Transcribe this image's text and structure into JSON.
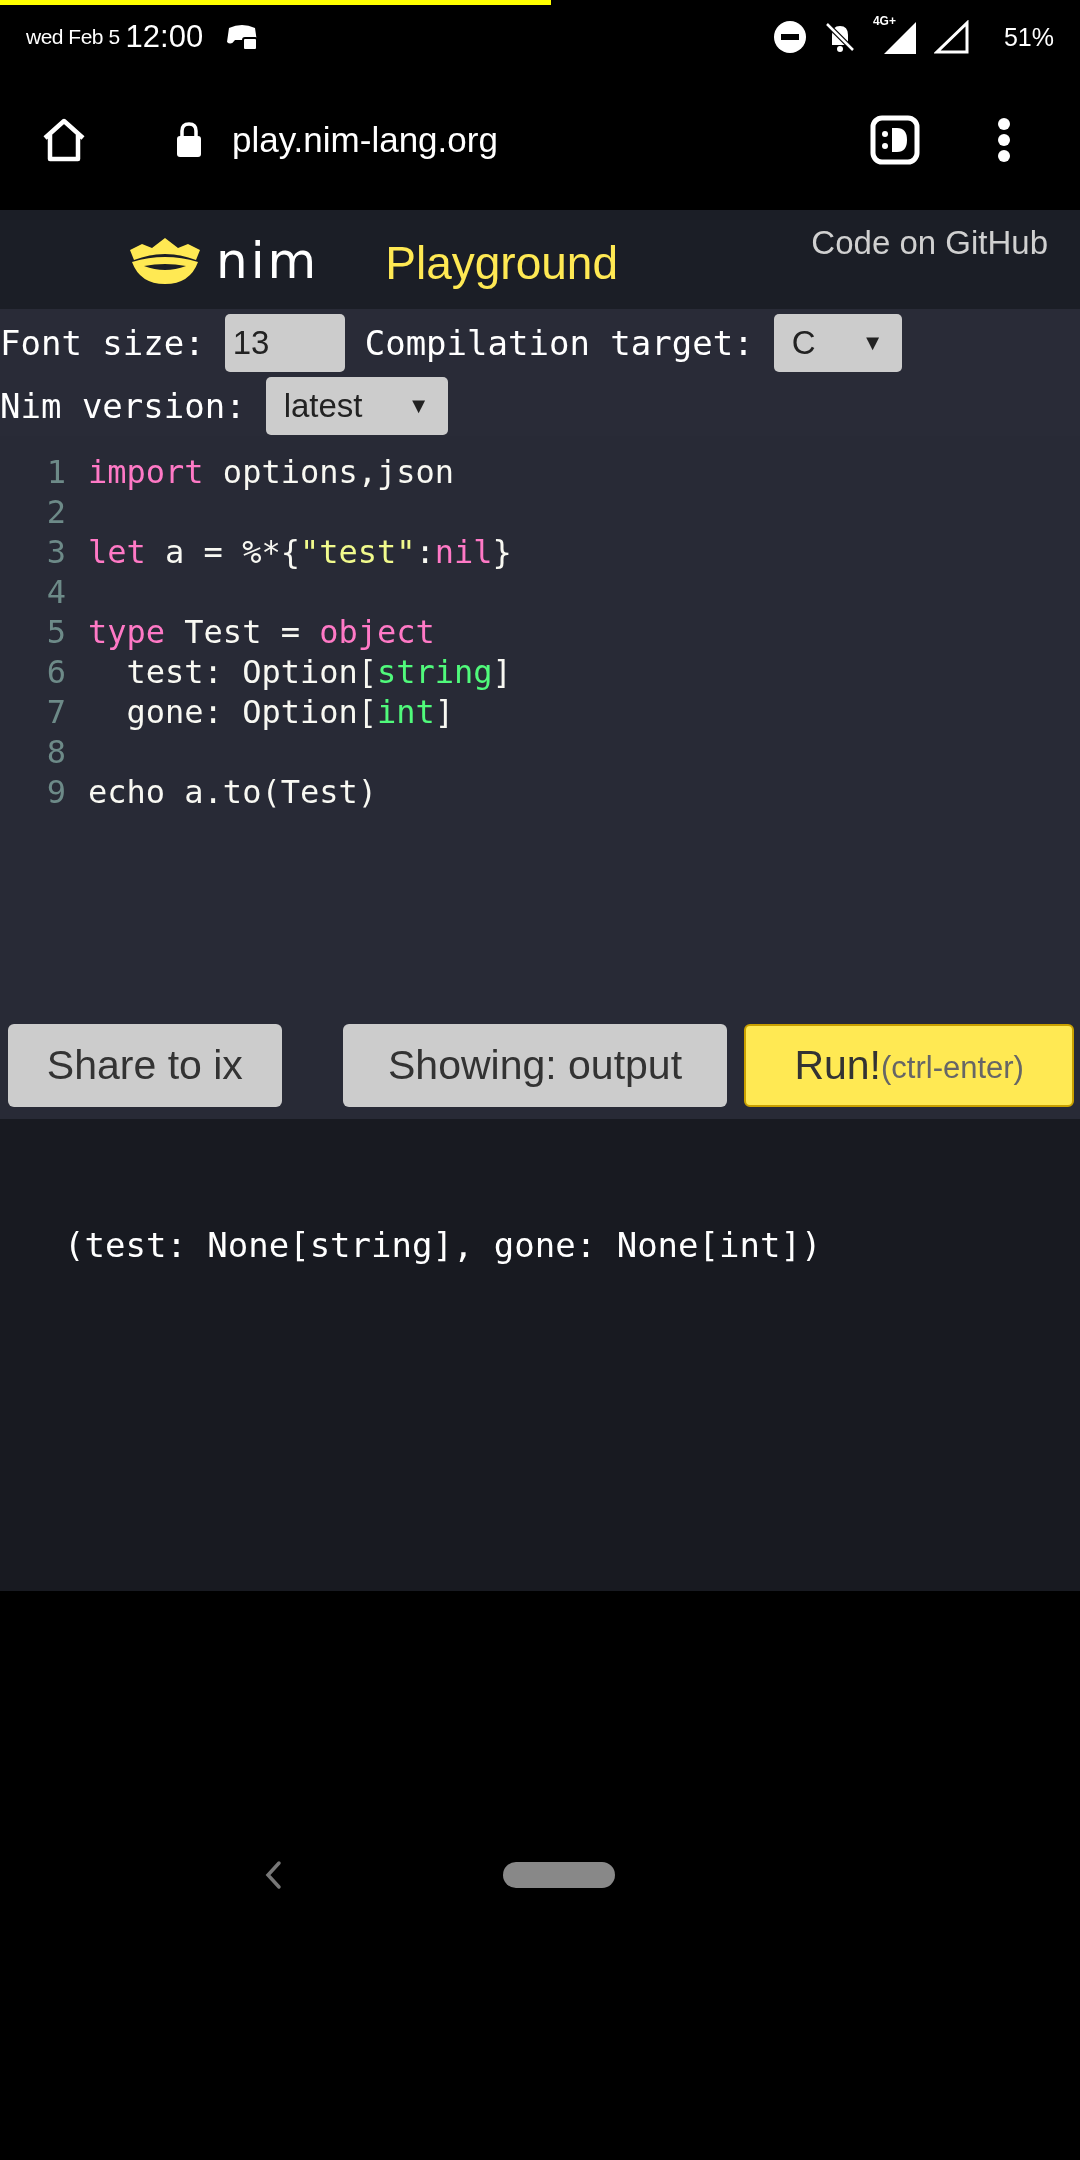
{
  "page_load": {
    "level": 0.51
  },
  "status_bar": {
    "date": "wed Feb 5",
    "time": "12:00",
    "network": "4G+",
    "battery": "51%"
  },
  "browser": {
    "url": "play.nim-lang.org"
  },
  "header": {
    "logo_text": "nim",
    "title": "Playground",
    "github_link": "Code on GitHub"
  },
  "controls": {
    "font_size_label": "Font size:",
    "font_size": "13",
    "target_label": "Compilation target:",
    "target": "C",
    "version_label": "Nim version:",
    "version": "latest",
    "dropdown_arrow": "▼"
  },
  "editor": {
    "lines": [
      {
        "number": "1",
        "tokens": [
          {
            "kind": "keyword",
            "text": "import"
          },
          {
            "kind": "plain",
            "text": " options,json"
          }
        ]
      },
      {
        "number": "2"
      },
      {
        "number": "3",
        "tokens": [
          {
            "kind": "keyword",
            "text": "let"
          },
          {
            "kind": "plain",
            "text": " a = %*{"
          },
          {
            "kind": "string",
            "text": "\"test\""
          },
          {
            "kind": "plain",
            "text": ":"
          },
          {
            "kind": "keyword",
            "text": "nil"
          },
          {
            "kind": "plain",
            "text": "}"
          }
        ]
      },
      {
        "number": "4"
      },
      {
        "number": "5",
        "tokens": [
          {
            "kind": "keyword",
            "text": "type"
          },
          {
            "kind": "plain",
            "text": " Test = "
          },
          {
            "kind": "keyword",
            "text": "object"
          }
        ]
      },
      {
        "number": "6",
        "tokens": [
          {
            "kind": "plain",
            "text": "  test: Option["
          },
          {
            "kind": "type",
            "text": "string"
          },
          {
            "kind": "plain",
            "text": "]"
          }
        ]
      },
      {
        "number": "7",
        "tokens": [
          {
            "kind": "plain",
            "text": "  gone: Option["
          },
          {
            "kind": "type",
            "text": "int"
          },
          {
            "kind": "plain",
            "text": "]"
          }
        ]
      },
      {
        "number": "8"
      },
      {
        "number": "9",
        "tokens": [
          {
            "kind": "plain",
            "text": "echo a.to(Test)"
          }
        ]
      }
    ]
  },
  "buttons": {
    "share": "Share to ix",
    "showing": "Showing: output",
    "run": "Run!",
    "run_hint": "(ctrl-enter)"
  },
  "output": {
    "text": "(test: None[string], gone: None[int])"
  }
}
